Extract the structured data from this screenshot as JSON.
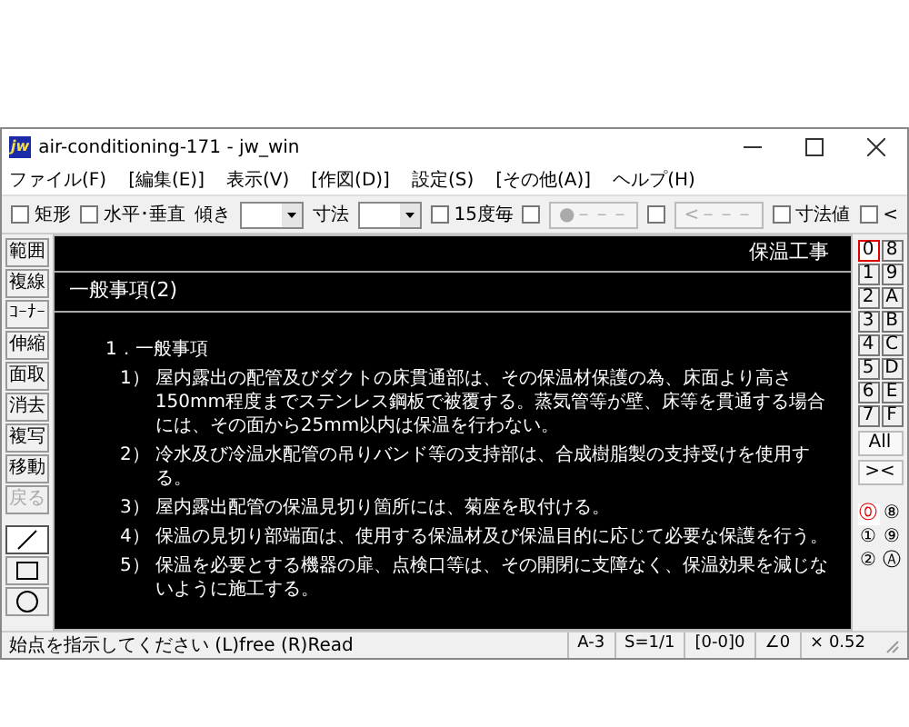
{
  "window": {
    "title": "air-conditioning-171 - jw_win",
    "logo": "jw"
  },
  "menu": [
    "ファイル(F)",
    "[編集(E)]",
    "表示(V)",
    "[作図(D)]",
    "設定(S)",
    "[その他(A)]",
    "ヘルプ(H)"
  ],
  "toolbar": [
    {
      "kind": "checkbox",
      "label": "矩形",
      "checked": false
    },
    {
      "kind": "checkbox",
      "label": "水平･垂直",
      "checked": false
    },
    {
      "kind": "label",
      "label": "傾き"
    },
    {
      "kind": "combo"
    },
    {
      "kind": "label",
      "label": "寸法"
    },
    {
      "kind": "combo"
    },
    {
      "kind": "checkbox",
      "label": "15度毎",
      "checked": false
    },
    {
      "kind": "checkbox",
      "checked": false
    },
    {
      "kind": "button",
      "label": "●－－－",
      "disabled": true
    },
    {
      "kind": "checkbox",
      "checked": false
    },
    {
      "kind": "button",
      "label": "<－－－",
      "disabled": true
    },
    {
      "kind": "checkbox",
      "label": "寸法値",
      "checked": false
    },
    {
      "kind": "checkbox",
      "label": "<",
      "checked": false
    }
  ],
  "tools": [
    {
      "label": "範囲",
      "disabled": false
    },
    {
      "label": "複線",
      "disabled": false
    },
    {
      "label": "ｺｰﾅｰ",
      "disabled": false
    },
    {
      "label": "伸縮",
      "disabled": false
    },
    {
      "label": "面取",
      "disabled": false
    },
    {
      "label": "消去",
      "disabled": false
    },
    {
      "label": "複写",
      "disabled": false
    },
    {
      "label": "移動",
      "disabled": false
    },
    {
      "label": "戻る",
      "disabled": true
    }
  ],
  "draw_tools": [
    {
      "kind": "line",
      "selected": true
    },
    {
      "kind": "rectangle",
      "selected": false
    },
    {
      "kind": "circle",
      "selected": false
    }
  ],
  "drawing": {
    "header": "保温工事",
    "title": "一般事項(2)",
    "heading": "1．一般事項",
    "items": [
      {
        "number": "1）",
        "text": "屋内露出の配管及びダクトの床貫通部は、その保温材保護の為、床面より高さ150mm程度までステンレス鋼板で被覆する。蒸気管等が壁、床等を貫通する場合には、その面から25mm以内は保温を行わない。"
      },
      {
        "number": "2）",
        "text": "冷水及び冷温水配管の吊りバンド等の支持部は、合成樹脂製の支持受けを使用する。"
      },
      {
        "number": "3）",
        "text": "屋内露出配管の保温見切り箇所には、菊座を取付ける。"
      },
      {
        "number": "4）",
        "text": "保温の見切り部端面は、使用する保温材及び保温目的に応じて必要な保護を行う。"
      },
      {
        "number": "5）",
        "text": "保温を必要とする機器の扉、点検口等は、その開閉に支障なく、保温効果を減じないように施工する。"
      }
    ]
  },
  "layers": [
    {
      "label": "0",
      "selected": true
    },
    {
      "label": "8",
      "selected": false
    },
    {
      "label": "1",
      "selected": false
    },
    {
      "label": "9",
      "selected": false
    },
    {
      "label": "2",
      "selected": false
    },
    {
      "label": "A",
      "selected": false
    },
    {
      "label": "3",
      "selected": false
    },
    {
      "label": "B",
      "selected": false
    },
    {
      "label": "4",
      "selected": false
    },
    {
      "label": "C",
      "selected": false
    },
    {
      "label": "5",
      "selected": false
    },
    {
      "label": "D",
      "selected": false
    },
    {
      "label": "6",
      "selected": false
    },
    {
      "label": "E",
      "selected": false
    },
    {
      "label": "7",
      "selected": false
    },
    {
      "label": "F",
      "selected": false
    }
  ],
  "layer_buttons": [
    "All",
    "><"
  ],
  "groups": [
    {
      "label": "⓪",
      "selected": true
    },
    {
      "label": "⑧",
      "selected": false
    },
    {
      "label": "①",
      "selected": false
    },
    {
      "label": "⑨",
      "selected": false
    },
    {
      "label": "②",
      "selected": false
    },
    {
      "label": "Ⓐ",
      "selected": false
    }
  ],
  "status": {
    "message": "始点を指示してください (L)free (R)Read",
    "cells": [
      "A-3",
      "S=1/1",
      "[0-0]0",
      "∠0",
      "× 0.52"
    ]
  }
}
